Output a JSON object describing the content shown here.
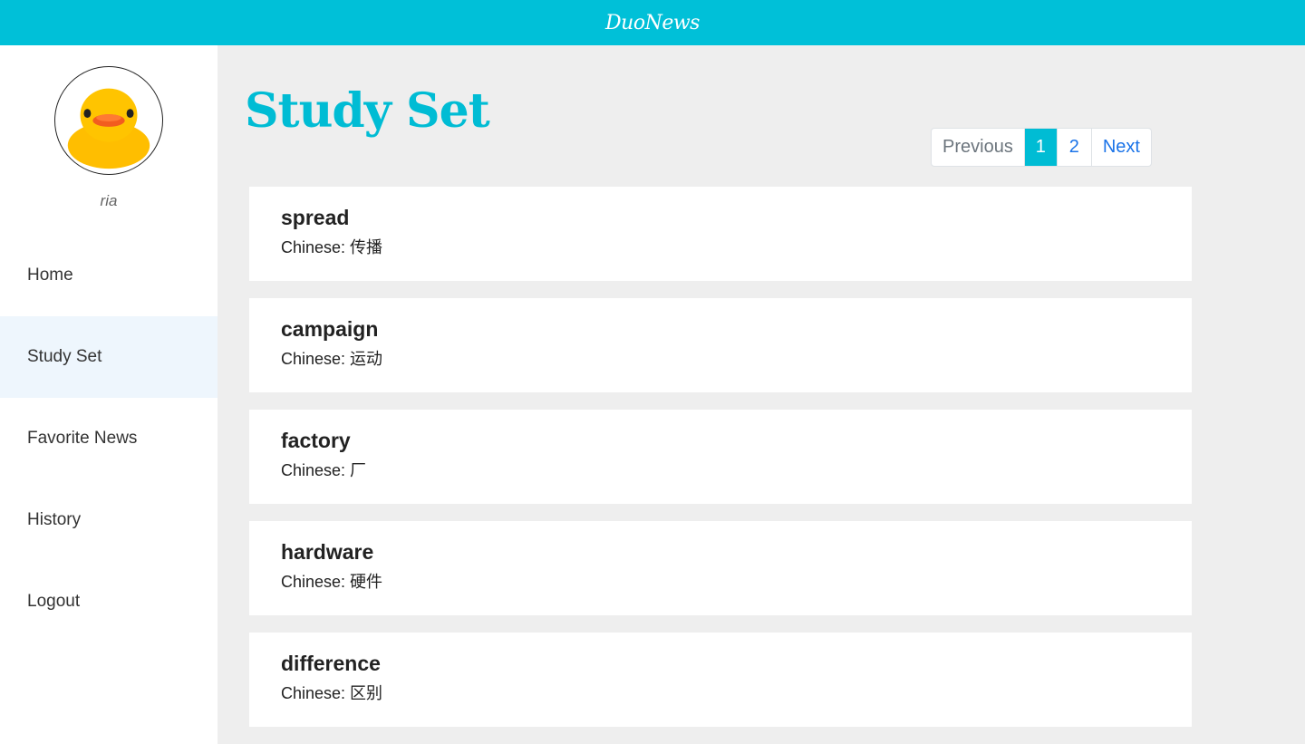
{
  "header": {
    "brand": "DuoNews"
  },
  "sidebar": {
    "username": "ria",
    "items": [
      {
        "label": "Home",
        "active": false
      },
      {
        "label": "Study Set",
        "active": true
      },
      {
        "label": "Favorite News",
        "active": false
      },
      {
        "label": "History",
        "active": false
      },
      {
        "label": "Logout",
        "active": false
      }
    ]
  },
  "main": {
    "title": "Study Set",
    "pagination": {
      "previous": "Previous",
      "pages": [
        "1",
        "2"
      ],
      "current": "1",
      "next": "Next"
    },
    "cards": [
      {
        "word": "spread",
        "translation": "Chinese: 传播"
      },
      {
        "word": "campaign",
        "translation": "Chinese: 运动"
      },
      {
        "word": "factory",
        "translation": "Chinese: 厂"
      },
      {
        "word": "hardware",
        "translation": "Chinese: 硬件"
      },
      {
        "word": "difference",
        "translation": "Chinese: 区别"
      }
    ]
  },
  "colors": {
    "accent": "#00c0d8",
    "link": "#1a73e8",
    "background": "#eeeeee"
  },
  "icons": {
    "avatar": "rubber-duck-avatar"
  }
}
